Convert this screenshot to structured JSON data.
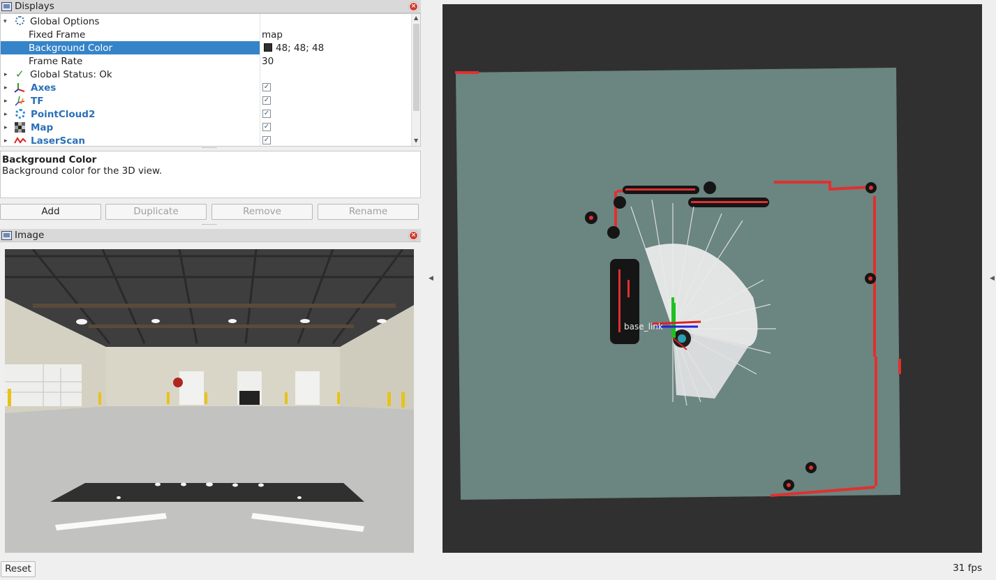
{
  "displays_panel": {
    "title": "Displays",
    "rows": [
      {
        "label": "Global Options",
        "value": ""
      },
      {
        "label": "Fixed Frame",
        "value": "map"
      },
      {
        "label": "Background Color",
        "value": "48; 48; 48"
      },
      {
        "label": "Frame Rate",
        "value": "30"
      },
      {
        "label": "Global Status: Ok",
        "value": ""
      },
      {
        "label": "Axes",
        "checked": true
      },
      {
        "label": "TF",
        "checked": true
      },
      {
        "label": "PointCloud2",
        "checked": true
      },
      {
        "label": "Map",
        "checked": true
      },
      {
        "label": "LaserScan",
        "checked": true
      }
    ],
    "selected_row": "Background Color",
    "background_color_swatch": "#303030"
  },
  "description": {
    "title": "Background Color",
    "text": "Background color for the 3D view."
  },
  "buttons": {
    "add": "Add",
    "duplicate": "Duplicate",
    "remove": "Remove",
    "rename": "Rename"
  },
  "image_panel": {
    "title": "Image"
  },
  "view3d": {
    "background": "#303030",
    "map_color": "#6b8580",
    "laser_color": "#e03030",
    "frame_label": "base_link"
  },
  "footer": {
    "reset": "Reset",
    "fps": "31 fps"
  }
}
